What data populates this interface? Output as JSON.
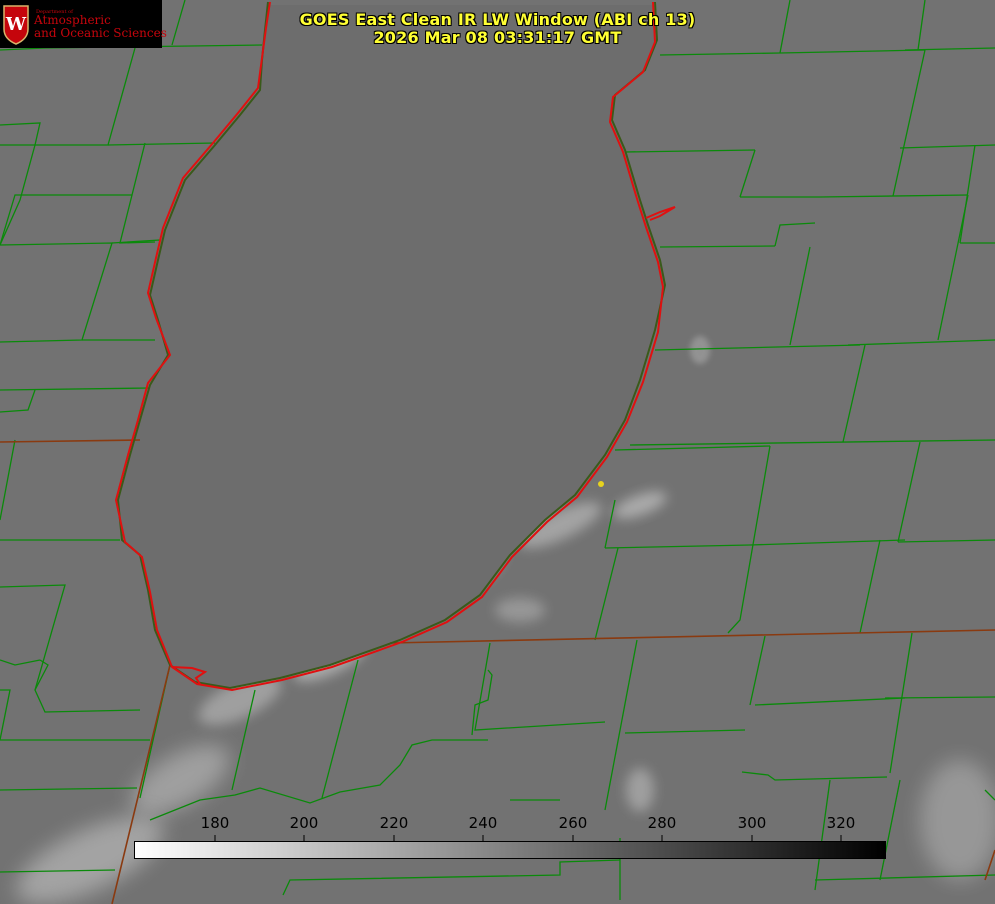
{
  "header": {
    "title_line1": "GOES East Clean IR LW Window (ABI ch 13)",
    "title_line2": "2026 Mar 08 03:31:17 GMT"
  },
  "logo": {
    "dept": "Department of",
    "line1": "Atmospheric",
    "line2": "and Oceanic Sciences",
    "emblem": "W"
  },
  "colorbar": {
    "tick_labels": [
      "180",
      "200",
      "220",
      "240",
      "260",
      "280",
      "300",
      "320"
    ]
  },
  "colors": {
    "background_gray": "#727272",
    "county_lines": "#0a8a0a",
    "shoreline": "#e01010",
    "state_lines": "#8a3a10",
    "title_text": "#ffff33",
    "marker": "#e6d21e",
    "logo_accent": "#c5050c"
  }
}
